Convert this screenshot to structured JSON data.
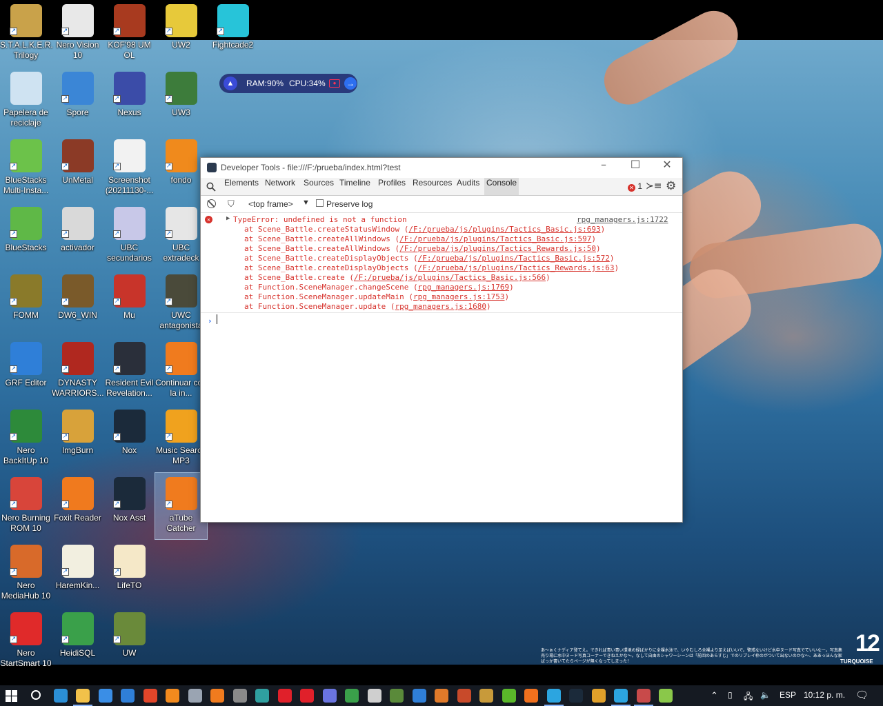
{
  "desktop": {
    "icons": [
      {
        "label": "S.T.A.L.K.E.R. Trilogy",
        "icon": "stalker-icon",
        "color": "#c9a24a"
      },
      {
        "label": "Nero Vision 10",
        "icon": "nero-vision-icon",
        "color": "#e8e8e8"
      },
      {
        "label": "KOF'98 UM OL",
        "icon": "kof98-icon",
        "color": "#a83a1f"
      },
      {
        "label": "UW2",
        "icon": "uw2-icon",
        "color": "#e7c93a"
      },
      {
        "label": "Fightcade2",
        "icon": "fightcade-icon",
        "color": "#27c4d9"
      },
      {
        "label": "Papelera de reciclaje",
        "icon": "recycle-bin-icon",
        "color": "#cfe3f2"
      },
      {
        "label": "Spore",
        "icon": "spore-icon",
        "color": "#3b86d6"
      },
      {
        "label": "Nexus",
        "icon": "nexus-icon",
        "color": "#3b4ca8"
      },
      {
        "label": "UW3",
        "icon": "uw3-icon",
        "color": "#3d7c3b"
      },
      {
        "label": "BlueStacks Multi-Insta...",
        "icon": "bluestacks-multi-icon",
        "color": "#6cc24a"
      },
      {
        "label": "UnMetal",
        "icon": "unmetal-icon",
        "color": "#8b3a26"
      },
      {
        "label": "Screenshot (20211130-...",
        "icon": "screenshot-icon",
        "color": "#f2f2f2"
      },
      {
        "label": "fondo",
        "icon": "fondo-icon",
        "color": "#f08a1c"
      },
      {
        "label": "BlueStacks",
        "icon": "bluestacks-icon",
        "color": "#5fb847"
      },
      {
        "label": "activador",
        "icon": "activador-icon",
        "color": "#d9d9d9"
      },
      {
        "label": "UBC secundarios",
        "icon": "ubc-secundarios-icon",
        "color": "#c8c8e8"
      },
      {
        "label": "UBC extradeck",
        "icon": "ubc-extradeck-icon",
        "color": "#e6e6e6"
      },
      {
        "label": "FOMM",
        "icon": "fomm-icon",
        "color": "#8a7a2a"
      },
      {
        "label": "DW6_WIN",
        "icon": "dw6-icon",
        "color": "#7a5a2a"
      },
      {
        "label": "Mu",
        "icon": "mu-icon",
        "color": "#c8342a"
      },
      {
        "label": "UWC antagonista",
        "icon": "uwc-icon",
        "color": "#4a4a3a"
      },
      {
        "label": "GRF Editor",
        "icon": "grf-editor-icon",
        "color": "#2f7fd8"
      },
      {
        "label": "DYNASTY WARRIORS...",
        "icon": "dynasty-warriors-icon",
        "color": "#b0281f"
      },
      {
        "label": "Resident Evil Revelation...",
        "icon": "resident-evil-icon",
        "color": "#2a2f3a"
      },
      {
        "label": "Continuar con la in...",
        "icon": "vlc-continue-icon",
        "color": "#f07b1e"
      },
      {
        "label": "Nero BackItUp 10",
        "icon": "nero-backitup-icon",
        "color": "#2d8a3a"
      },
      {
        "label": "ImgBurn",
        "icon": "imgburn-icon",
        "color": "#d8a23a"
      },
      {
        "label": "Nox",
        "icon": "nox-icon",
        "color": "#1b2a3a"
      },
      {
        "label": "Music Search MP3",
        "icon": "music-search-icon",
        "color": "#f0a21e"
      },
      {
        "label": "Nero Burning ROM 10",
        "icon": "nero-burning-icon",
        "color": "#d8453a"
      },
      {
        "label": "Foxit Reader",
        "icon": "foxit-icon",
        "color": "#f07a1e"
      },
      {
        "label": "Nox Asst",
        "icon": "nox-asst-icon",
        "color": "#1b2a3a"
      },
      {
        "label": "aTube Catcher",
        "icon": "atube-icon",
        "color": "#f07b1e"
      },
      {
        "label": "Nero MediaHub 10",
        "icon": "nero-mediahub-icon",
        "color": "#d86a2a"
      },
      {
        "label": "HaremKin...",
        "icon": "haremkin-icon",
        "color": "#f2efe0"
      },
      {
        "label": "LifeTO",
        "icon": "lifeto-icon",
        "color": "#f5e8c8"
      },
      {
        "label": "Nero StartSmart 10",
        "icon": "nero-startsmart-icon",
        "color": "#e02a2a"
      },
      {
        "label": "HeidiSQL",
        "icon": "heidisql-icon",
        "color": "#3aa04a"
      },
      {
        "label": "UW",
        "icon": "uw-icon",
        "color": "#6a8a3a"
      }
    ],
    "wallpaper": {
      "logo_number": "12",
      "logo_word": "TURQUOISE",
      "caption": "あ～ぁくナディア登てえ。できれば青い青い環境の緑ばかりに全裸水泳で、いやむしろ全裸より足えばいいで。警戒ないけど水中ヌード写真でていいなー。写真集売り場に水中ヌード写真コーナーできねえかな～。なして自由のシャワーシーンは「前回のあらすじ」でのリプレイ枠のがついて出ないのかな～、ああっほんな家ばっか書いてたらページが無くなってしまった！"
    }
  },
  "sysmon": {
    "ram": "RAM:90%",
    "cpu": "CPU:34%"
  },
  "devtools": {
    "title": "Developer Tools - file:///F:/prueba/index.html?test",
    "tabs": [
      "Elements",
      "Network",
      "Sources",
      "Timeline",
      "Profiles",
      "Resources",
      "Audits",
      "Console"
    ],
    "active_tab": "Console",
    "error_count": "1",
    "frame_select": "<top frame>",
    "preserve_log": "Preserve log",
    "error": {
      "message": "TypeError: undefined is not a function",
      "source": "rpg_managers.js:1722",
      "stack": [
        {
          "fn": "at Scene_Battle.createStatusWindow (",
          "link": "/F:/prueba/js/plugins/Tactics_Basic.js:693",
          "end": ")"
        },
        {
          "fn": "at Scene_Battle.createAllWindows (",
          "link": "/F:/prueba/js/plugins/Tactics_Basic.js:597",
          "end": ")"
        },
        {
          "fn": "at Scene_Battle.createAllWindows (",
          "link": "/F:/prueba/js/plugins/Tactics_Rewards.js:50",
          "end": ")"
        },
        {
          "fn": "at Scene_Battle.createDisplayObjects (",
          "link": "/F:/prueba/js/plugins/Tactics_Basic.js:572",
          "end": ")"
        },
        {
          "fn": "at Scene_Battle.createDisplayObjects (",
          "link": "/F:/prueba/js/plugins/Tactics_Rewards.js:63",
          "end": ")"
        },
        {
          "fn": "at Scene_Battle.create (",
          "link": "/F:/prueba/js/plugins/Tactics_Basic.js:566",
          "end": ")"
        },
        {
          "fn": "at Function.SceneManager.changeScene (",
          "link": "rpg_managers.js:1769",
          "end": ")"
        },
        {
          "fn": "at Function.SceneManager.updateMain (",
          "link": "rpg_managers.js:1753",
          "end": ")"
        },
        {
          "fn": "at Function.SceneManager.update (",
          "link": "rpg_managers.js:1680",
          "end": ")"
        }
      ]
    }
  },
  "taskbar": {
    "apps": [
      {
        "icon": "search-icon",
        "color": "#151a22"
      },
      {
        "icon": "edge-icon",
        "color": "#2b8fd6"
      },
      {
        "icon": "file-explorer-icon",
        "color": "#f2c14a"
      },
      {
        "icon": "store-icon",
        "color": "#3a8ee6"
      },
      {
        "icon": "mail-icon",
        "color": "#2f7fd8"
      },
      {
        "icon": "office-icon",
        "color": "#e2462a"
      },
      {
        "icon": "avast-icon",
        "color": "#f28a1e"
      },
      {
        "icon": "steam-user-icon",
        "color": "#9aa4b2"
      },
      {
        "icon": "vlc-icon",
        "color": "#f07b1e"
      },
      {
        "icon": "epic-icon",
        "color": "#8a8a8a"
      },
      {
        "icon": "snipping-icon",
        "color": "#2fa0a0"
      },
      {
        "icon": "opera-icon",
        "color": "#e0202a"
      },
      {
        "icon": "foxit-taskbar-icon",
        "color": "#e0202a"
      },
      {
        "icon": "discord-icon",
        "color": "#6a74e0"
      },
      {
        "icon": "xbox-icon",
        "color": "#3aa04a"
      },
      {
        "icon": "mask-icon",
        "color": "#cfcfcf"
      },
      {
        "icon": "minecraft-icon",
        "color": "#5a8a3a"
      },
      {
        "icon": "bolt-icon",
        "color": "#2f7fd8"
      },
      {
        "icon": "game-icon",
        "color": "#e07a2a"
      },
      {
        "icon": "briefcase-icon",
        "color": "#c84a2a"
      },
      {
        "icon": "dw-icon",
        "color": "#c89a3a"
      },
      {
        "icon": "git-icon",
        "color": "#5ab82a"
      },
      {
        "icon": "firefox-icon",
        "color": "#f0701e"
      },
      {
        "icon": "telegram-icon",
        "color": "#2ca5e0"
      },
      {
        "icon": "nox-taskbar-icon",
        "color": "#1b2a3a"
      },
      {
        "icon": "file-icon",
        "color": "#e0a02a"
      },
      {
        "icon": "telegram2-icon",
        "color": "#2ca5e0"
      },
      {
        "icon": "rpgmaker-icon",
        "color": "#c84a4a"
      },
      {
        "icon": "rpgmaker2-icon",
        "color": "#8ac84a"
      }
    ],
    "tray": {
      "language": "ESP",
      "time": "10:12 p. m."
    }
  }
}
